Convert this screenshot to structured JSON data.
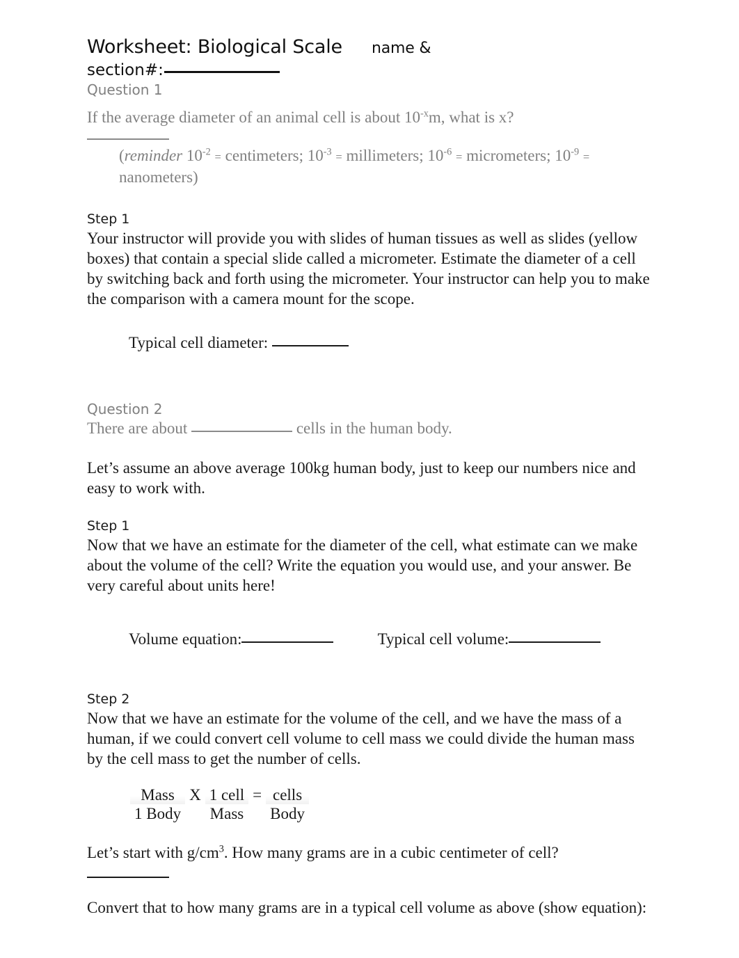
{
  "document": {
    "title_main": "Worksheet: Biological Scale",
    "title_name_label": "name &",
    "title_section_label": "section#:"
  },
  "question1": {
    "heading": "Question 1",
    "prompt_before": "If the average diameter of an animal cell is about 10",
    "prompt_exponent": "-x",
    "prompt_after": "m, what is x?",
    "reminder": {
      "open_paren": "(",
      "italic_word": "reminder",
      "base1": "10",
      "exp1": "-2",
      "eq1": "=",
      "unit1": "centimeters;",
      "base2": "10",
      "exp2": "-3",
      "eq2": "=",
      "unit2": "millimeters;",
      "base3": "10",
      "exp3": "-6",
      "eq3": "=",
      "unit3": "micrometers;",
      "base4": "10",
      "exp4": "-9",
      "eq4": "=",
      "unit4": "nanometers)"
    },
    "step1": {
      "heading": "Step 1",
      "body": "Your instructor will provide you with slides of human tissues as well as slides (yellow boxes) that contain a special slide called a micrometer. Estimate the diameter of a cell by switching back and forth using the micrometer. Your instructor can help you to make the comparison with a camera mount for the scope.",
      "answer_label": "Typical cell diameter:"
    }
  },
  "question2": {
    "heading": "Question 2",
    "line_before": "There are about",
    "line_after": "cells in the human body.",
    "assumption": "Let’s assume an above average 100kg human body, just to keep our numbers nice and easy to work with.",
    "step1": {
      "heading": "Step 1",
      "body": "Now that we have an estimate for the diameter of the cell, what estimate can we make about the volume of the cell? Write the equation you would use, and your answer. Be very careful about units here!",
      "answer_label_1": "Volume equation:",
      "answer_label_2": "Typical cell volume:"
    },
    "step2": {
      "heading": "Step 2",
      "body": "Now that we have an estimate for the volume of the cell, and we have the mass of a human, if we could convert cell volume to cell mass we could divide the human mass by the cell mass to get the number of cells.",
      "equation": {
        "numerators": [
          "Mass",
          "1 cell",
          "cells"
        ],
        "denominators": [
          "1 Body",
          "Mass",
          "Body"
        ],
        "operator_multiply": "X",
        "operator_equals": "="
      },
      "grams_question_before": "Let’s start with g/cm",
      "grams_question_exponent": "3",
      "grams_question_after": ".  How many grams are in a cubic centimeter of cell?",
      "convert_question": "Convert that to how many grams are in a typical cell volume as above (show equation):"
    }
  },
  "colors": {
    "body_text": "#1a1a1a",
    "muted_text": "#808080",
    "blank_rule": "#1a1a1a",
    "blank_rule_muted": "#8a8a8a",
    "background": "#ffffff"
  }
}
